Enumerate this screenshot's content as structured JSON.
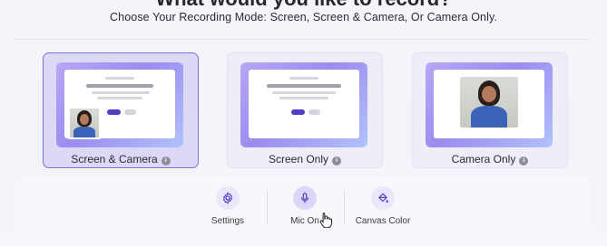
{
  "header": {
    "title_partial": "What would you like to record?",
    "subtitle": "Choose Your Recording Mode: Screen, Screen & Camera, Or Camera Only."
  },
  "modes": [
    {
      "label": "Screen & Camera",
      "selected": true
    },
    {
      "label": "Screen Only",
      "selected": false
    },
    {
      "label": "Camera Only",
      "selected": false
    }
  ],
  "info_glyph": "i",
  "toolbar": {
    "settings_label": "Settings",
    "mic_label": "Mic On",
    "canvas_label": "Canvas Color"
  },
  "colors": {
    "accent": "#4a3fc5",
    "selected_border": "#7a72da",
    "selected_bg": "#dcd9f7"
  },
  "icons": [
    "gear-icon",
    "microphone-icon",
    "paint-bucket-icon",
    "info-icon",
    "hand-cursor-icon"
  ]
}
